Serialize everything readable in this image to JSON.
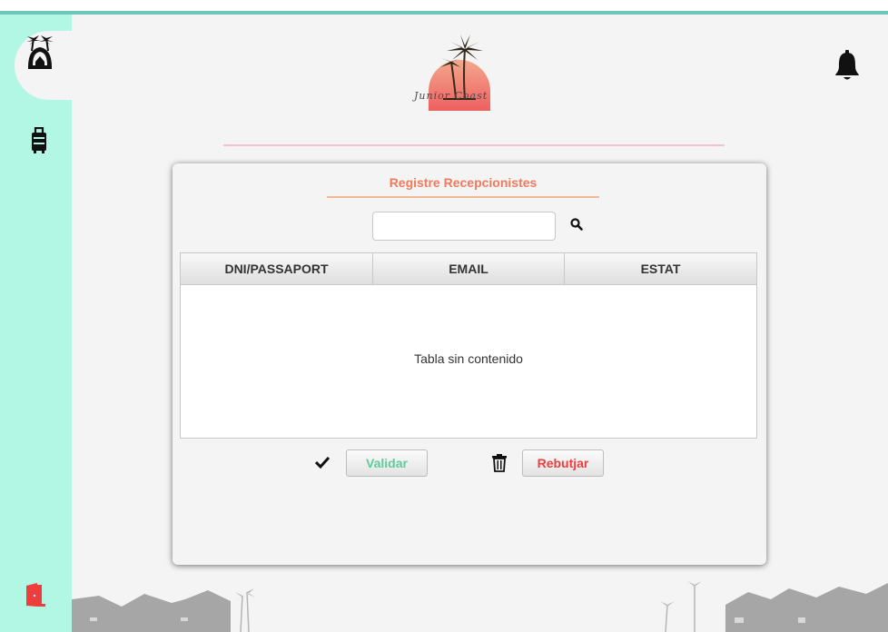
{
  "sidebar": {
    "items": [
      {
        "name": "home",
        "icon": "palm-house-icon"
      },
      {
        "name": "bookings",
        "icon": "luggage-icon"
      },
      {
        "name": "logout",
        "icon": "exit-door-icon"
      }
    ],
    "accent": "#b2f6e4"
  },
  "header": {
    "logo_text": "Junior Coast",
    "notification_icon": "bell-icon"
  },
  "panel": {
    "title": "Registre Recepcionistes",
    "search": {
      "value": "",
      "placeholder": ""
    },
    "table": {
      "columns": [
        "DNI/PASSAPORT",
        "EMAIL",
        "ESTAT"
      ],
      "rows": [],
      "empty_message": "Tabla sin contenido"
    },
    "actions": {
      "validate_label": "Validar",
      "reject_label": "Rebutjar"
    }
  },
  "colors": {
    "title": "#f07a5c",
    "validate": "#5fcc9a",
    "reject": "#ee3d3d",
    "divider": "#f3c2d2"
  }
}
